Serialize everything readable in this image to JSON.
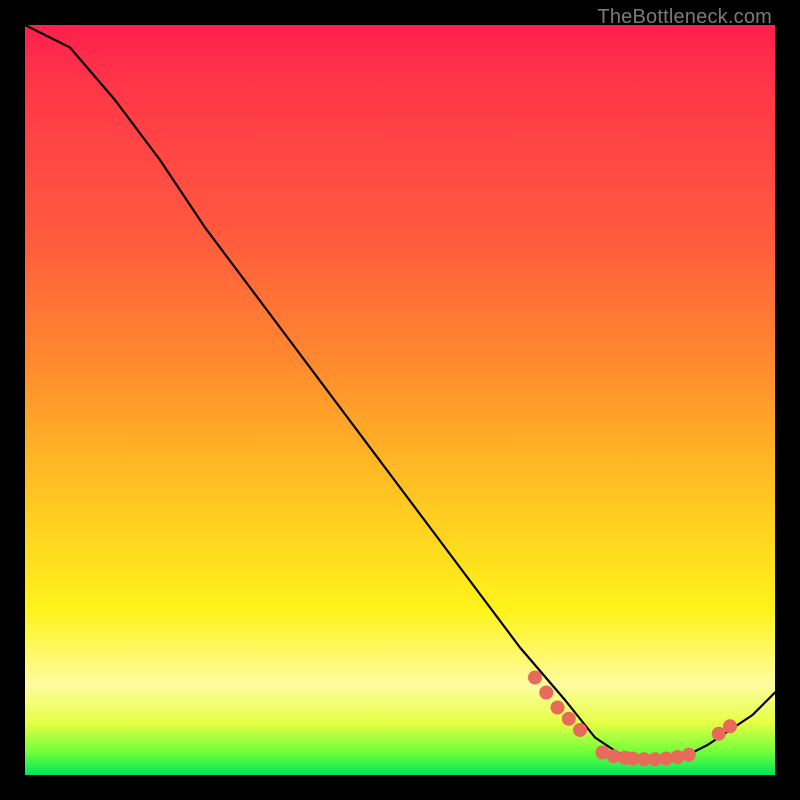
{
  "attribution": "TheBottleneck.com",
  "colors": {
    "marker": "#e86a5a",
    "curve": "#000000",
    "background": "#000000"
  },
  "chart_data": {
    "type": "line",
    "title": "",
    "xlabel": "",
    "ylabel": "",
    "xlim": [
      0,
      100
    ],
    "ylim": [
      0,
      100
    ],
    "grid": false,
    "legend": false,
    "series": [
      {
        "name": "curve",
        "x": [
          0,
          6,
          12,
          18,
          24,
          30,
          36,
          42,
          48,
          54,
          60,
          66,
          72,
          76,
          79,
          82,
          85,
          88,
          91,
          94,
          97,
          100
        ],
        "y": [
          100,
          97,
          90,
          82,
          73,
          65,
          57,
          49,
          41,
          33,
          25,
          17,
          10,
          5,
          3,
          2,
          2,
          2.5,
          4,
          6,
          8,
          11
        ]
      }
    ],
    "markers": [
      {
        "x": 68,
        "y": 13
      },
      {
        "x": 69.5,
        "y": 11
      },
      {
        "x": 71,
        "y": 9
      },
      {
        "x": 72.5,
        "y": 7.5
      },
      {
        "x": 74,
        "y": 6
      },
      {
        "x": 77,
        "y": 3
      },
      {
        "x": 78.5,
        "y": 2.5
      },
      {
        "x": 80,
        "y": 2.3
      },
      {
        "x": 81,
        "y": 2.2
      },
      {
        "x": 82.5,
        "y": 2.1
      },
      {
        "x": 84,
        "y": 2.1
      },
      {
        "x": 85.5,
        "y": 2.2
      },
      {
        "x": 87,
        "y": 2.4
      },
      {
        "x": 88.5,
        "y": 2.7
      },
      {
        "x": 92.5,
        "y": 5.5
      },
      {
        "x": 94,
        "y": 6.5
      }
    ]
  }
}
